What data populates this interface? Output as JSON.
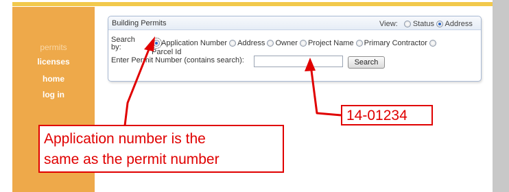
{
  "sidebar": {
    "items": [
      {
        "label": "permits"
      },
      {
        "label": "licenses"
      },
      {
        "label": "home"
      },
      {
        "label": "log in"
      }
    ]
  },
  "panel": {
    "title": "Building Permits",
    "view_label": "View:",
    "view_options": [
      {
        "label": "Status",
        "selected": false
      },
      {
        "label": "Address",
        "selected": true
      }
    ],
    "search_by_line1": "Search",
    "search_by_line2": "by:",
    "search_options": [
      {
        "label": "Application Number",
        "selected": true
      },
      {
        "label": "Address",
        "selected": false
      },
      {
        "label": "Owner",
        "selected": false
      },
      {
        "label": "Project Name",
        "selected": false
      },
      {
        "label": "Primary Contractor",
        "selected": false
      },
      {
        "label": "Parcel Id",
        "selected": false
      }
    ],
    "enter_label": "Enter Permit Number (contains search):",
    "input_value": "",
    "search_button": "Search"
  },
  "annotations": {
    "left_line1": "Application number is the",
    "left_line2": "same as the permit number",
    "right": "14-01234",
    "color": "#e00000"
  },
  "colors": {
    "sidebar": "#eea94a",
    "accent": "#f2c94c",
    "gutter": "#c8c8c8"
  }
}
